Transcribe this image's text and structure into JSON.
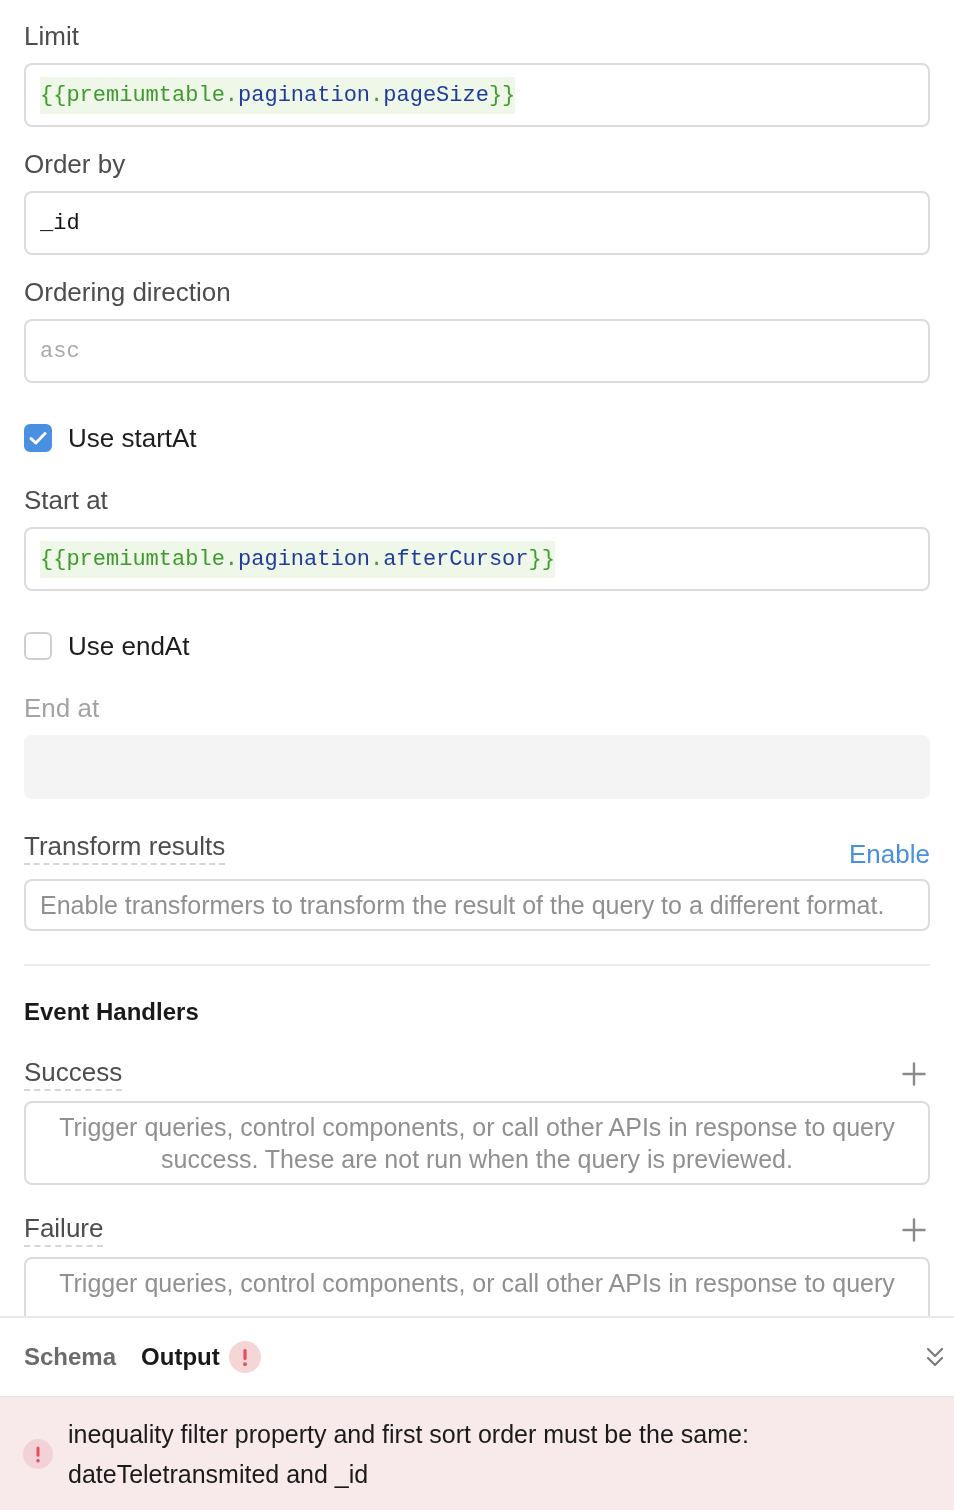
{
  "form": [
    {
      "kind": "input",
      "label": "Limit",
      "value": "{{premiumtable.pagination.pageSize}}",
      "disabled": false
    },
    {
      "kind": "input",
      "label": "Order by",
      "value": "_id",
      "disabled": false
    },
    {
      "kind": "input",
      "label": "Ordering direction",
      "placeholder": "asc",
      "disabled": false
    },
    {
      "kind": "checkbox",
      "label": "Use startAt",
      "checked": true
    },
    {
      "kind": "input",
      "label": "Start at",
      "value": "{{premiumtable.pagination.afterCursor}}",
      "disabled": false
    },
    {
      "kind": "checkbox",
      "label": "Use endAt",
      "checked": false
    },
    {
      "kind": "input",
      "label": "End at",
      "disabled": true
    }
  ],
  "transform": {
    "label": "Transform results",
    "action": "Enable",
    "description": "Enable transformers to transform the result of the query to a different format."
  },
  "event_handlers": {
    "title": "Event Handlers",
    "handlers": [
      {
        "label": "Success",
        "description": "Trigger queries, control components, or call other APIs in response to query success. These are not run when the query is previewed."
      },
      {
        "label": "Failure",
        "description": "Trigger queries, control components, or call other APIs in response to query"
      }
    ]
  },
  "output_panel": {
    "tabs": [
      {
        "label": "Schema",
        "selected": false,
        "error": false
      },
      {
        "label": "Output",
        "selected": true,
        "error": true
      }
    ]
  },
  "error": {
    "message": "inequality filter property and first sort order must be the same: dateTeletransmited and _id"
  }
}
